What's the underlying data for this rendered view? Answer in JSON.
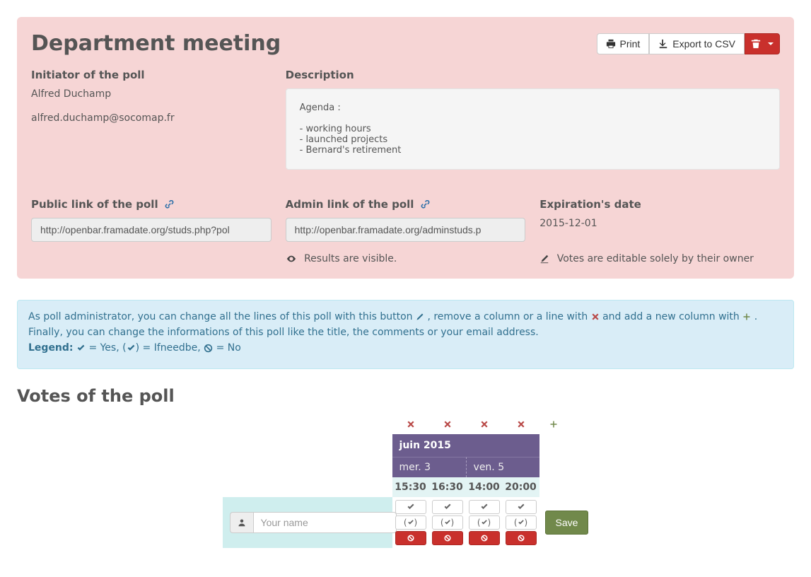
{
  "header": {
    "title": "Department meeting",
    "print": "Print",
    "export": "Export to CSV"
  },
  "initiator": {
    "label": "Initiator of the poll",
    "name": "Alfred Duchamp",
    "email": "alfred.duchamp@socomap.fr"
  },
  "description": {
    "label": "Description",
    "text": "Agenda :\n\n- working hours\n- launched projects\n- Bernard's retirement"
  },
  "publicLink": {
    "label": "Public link of the poll",
    "value": "http://openbar.framadate.org/studs.php?pol"
  },
  "adminLink": {
    "label": "Admin link of the poll",
    "value": "http://openbar.framadate.org/adminstuds.p",
    "resultsVisible": "Results are visible."
  },
  "expiration": {
    "label": "Expiration's date",
    "date": "2015-12-01",
    "editNote": "Votes are editable solely by their owner"
  },
  "adminAlert": {
    "line1a": "As poll administrator, you can change all the lines of this poll with this button ",
    "line1b": ", remove a column or a line with ",
    "line1c": " and add a new column with ",
    "line1d": ".",
    "line2": "Finally, you can change the informations of this poll like the title, the comments or your email address.",
    "legendLabel": "Legend:",
    "yes": " = Yes, ",
    "ifneedbe": " = Ifneedbe, ",
    "no": " = No"
  },
  "votes": {
    "title": "Votes of the poll",
    "month": "juin 2015",
    "days": [
      "mer. 3",
      "ven. 5"
    ],
    "times": [
      "15:30",
      "16:30",
      "14:00",
      "20:00"
    ],
    "namePlaceholder": "Your name",
    "save": "Save"
  }
}
